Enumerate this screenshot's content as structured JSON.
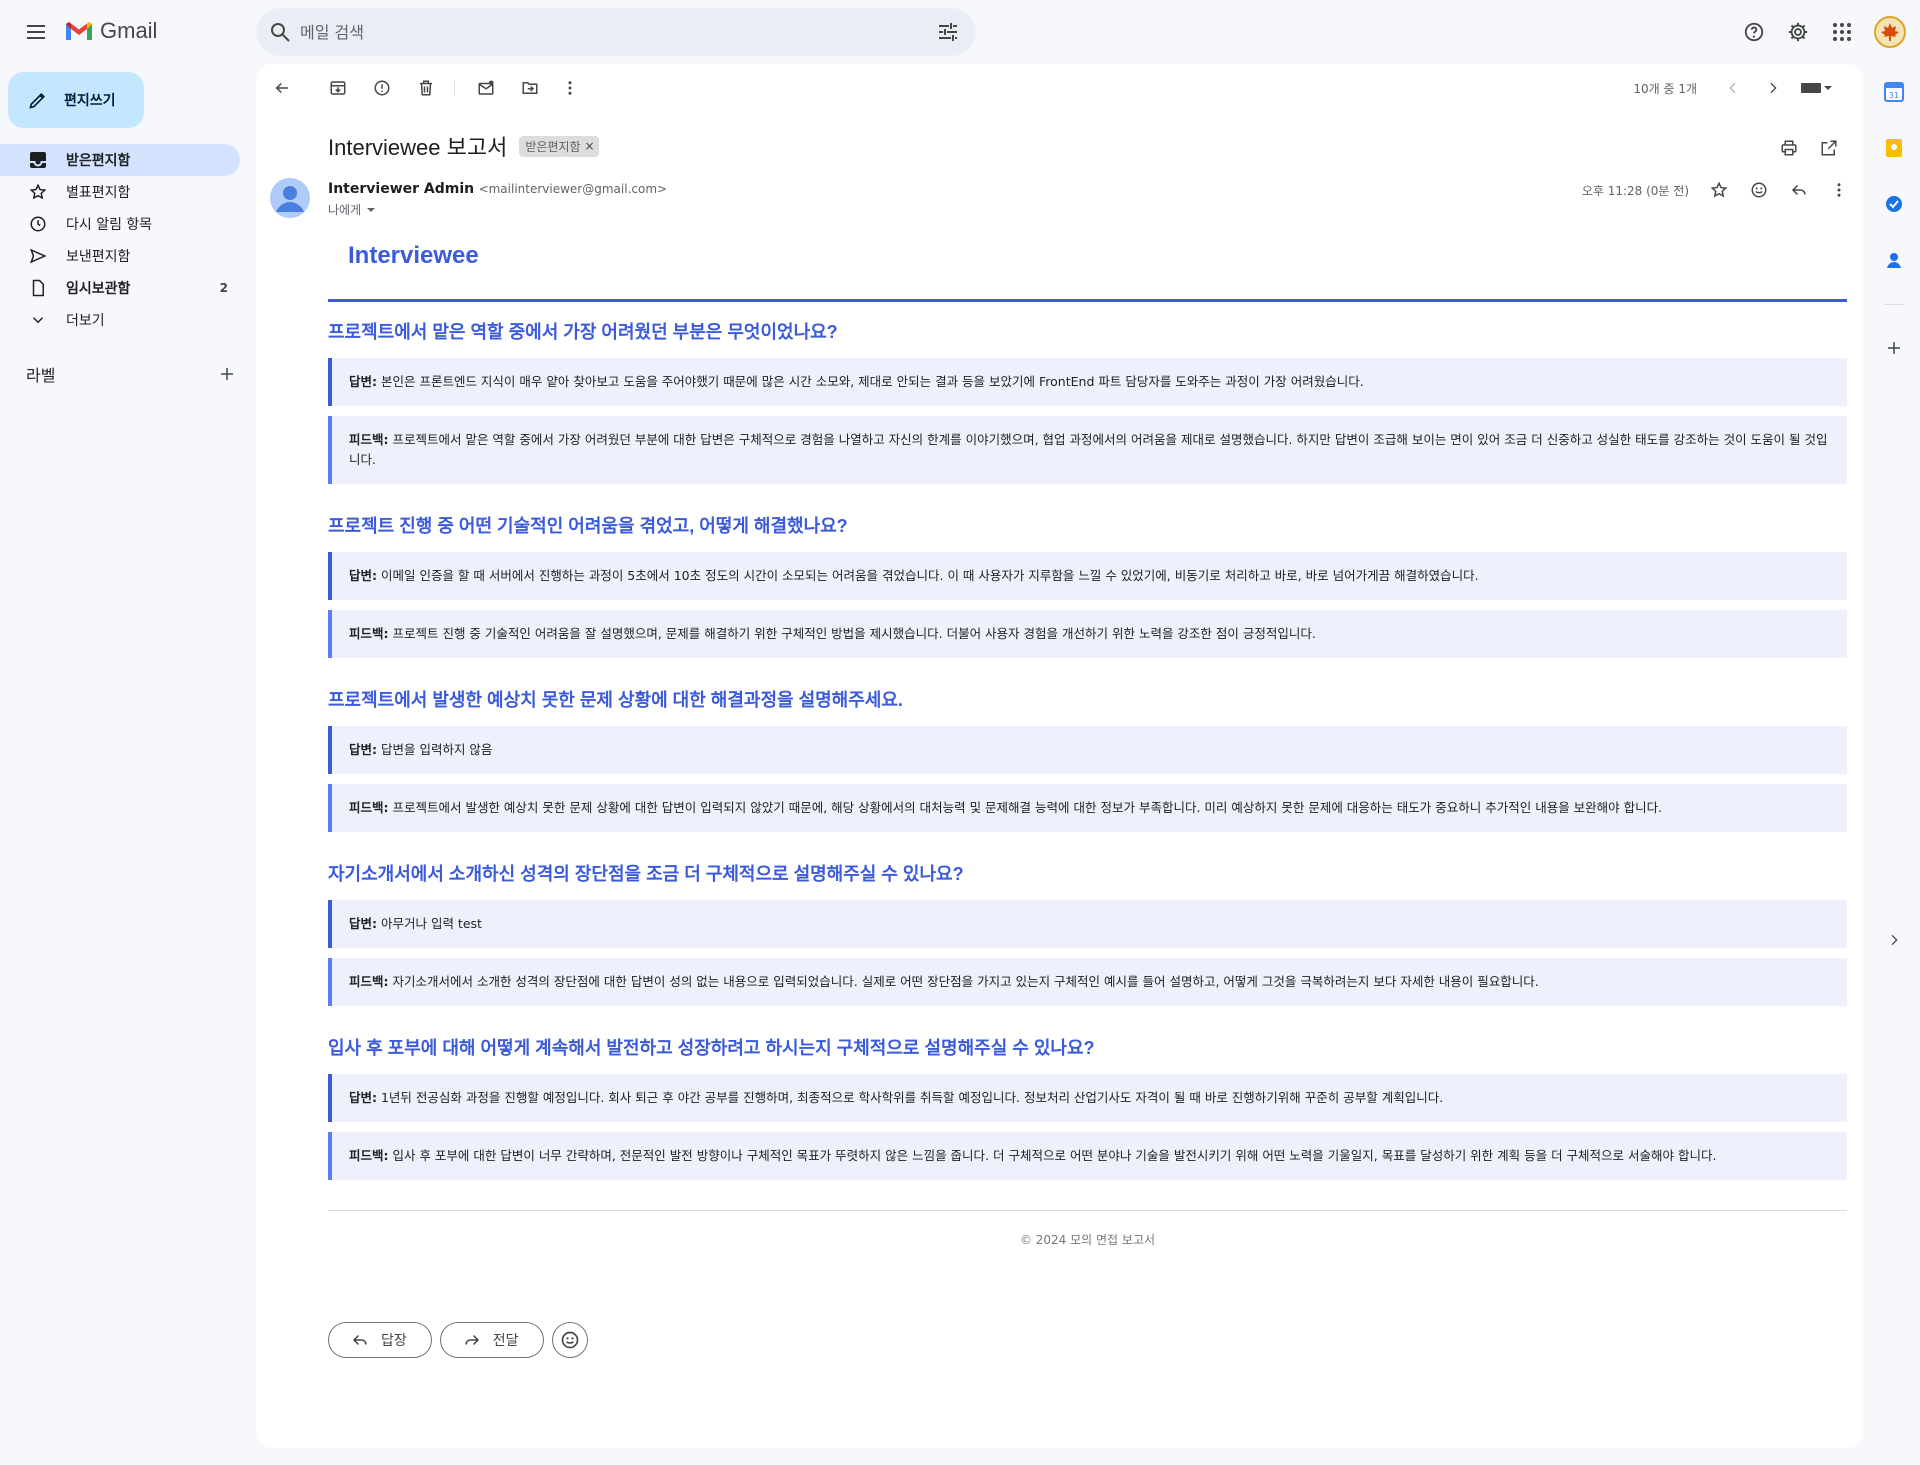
{
  "app": {
    "name": "Gmail"
  },
  "search": {
    "placeholder": "메일 검색"
  },
  "compose": {
    "label": "편지쓰기"
  },
  "nav": [
    {
      "label": "받은편지함",
      "count": "",
      "icon": "inbox-icon"
    },
    {
      "label": "별표편지함",
      "count": "",
      "icon": "star-icon"
    },
    {
      "label": "다시 알림 항목",
      "count": "",
      "icon": "clock-icon"
    },
    {
      "label": "보낸편지함",
      "count": "",
      "icon": "send-icon"
    },
    {
      "label": "임시보관함",
      "count": "2",
      "icon": "draft-icon"
    },
    {
      "label": "더보기",
      "count": "",
      "icon": "chevron-down-icon"
    }
  ],
  "labels_heading": "라벨",
  "pager": "10개 중 1개",
  "email": {
    "subject": "Interviewee 보고서",
    "label_chip": "받은편지함",
    "sender_name": "Interviewer Admin",
    "sender_email": "<mailinterviewer@gmail.com>",
    "to": "나에게",
    "time": "오후 11:28 (0분 전)"
  },
  "report": {
    "title": "Interviewee",
    "answer_label": "답변:",
    "feedback_label": "피드백:",
    "items": [
      {
        "question": "프로젝트에서 맡은 역할 중에서 가장 어려웠던 부분은 무엇이었나요?",
        "answer": "본인은 프론트엔드 지식이 매우 얕아 찾아보고 도움을 주어야했기 때문에 많은 시간 소모와, 제대로 안되는 결과 등을 보았기에 FrontEnd 파트 담당자를 도와주는 과정이 가장 어려웠습니다.",
        "feedback": "프로젝트에서 맡은 역할 중에서 가장 어려웠던 부분에 대한 답변은 구체적으로 경험을 나열하고 자신의 한계를 이야기했으며, 협업 과정에서의 어려움을 제대로 설명했습니다. 하지만 답변이 조급해 보이는 면이 있어 조금 더 신중하고 성실한 태도를 강조하는 것이 도움이 될 것입니다."
      },
      {
        "question": "프로젝트 진행 중 어떤 기술적인 어려움을 겪었고, 어떻게 해결했나요?",
        "answer": "이메일 인증을 할 때 서버에서 진행하는 과정이 5초에서 10초 정도의 시간이 소모되는 어려움을 겪었습니다. 이 때 사용자가 지루함을 느낄 수 있었기에, 비동기로 처리하고 바로, 바로 넘어가게끔 해결하였습니다.",
        "feedback": "프로젝트 진행 중 기술적인 어려움을 잘 설명했으며, 문제를 해결하기 위한 구체적인 방법을 제시했습니다. 더불어 사용자 경험을 개선하기 위한 노력을 강조한 점이 긍정적입니다."
      },
      {
        "question": "프로젝트에서 발생한 예상치 못한 문제 상황에 대한 해결과정을 설명해주세요.",
        "answer": "답변을 입력하지 않음",
        "feedback": "프로젝트에서 발생한 예상치 못한 문제 상황에 대한 답변이 입력되지 않았기 때문에, 해당 상황에서의 대처능력 및 문제해결 능력에 대한 정보가 부족합니다. 미리 예상하지 못한 문제에 대응하는 태도가 중요하니 추가적인 내용을 보완해야 합니다."
      },
      {
        "question": "자기소개서에서 소개하신 성격의 장단점을 조금 더 구체적으로 설명해주실 수 있나요?",
        "answer": "아무거나 입력 test",
        "feedback": "자기소개서에서 소개한 성격의 장단점에 대한 답변이 성의 없는 내용으로 입력되었습니다. 실제로 어떤 장단점을 가지고 있는지 구체적인 예시를 들어 설명하고, 어떻게 그것을 극복하려는지 보다 자세한 내용이 필요합니다."
      },
      {
        "question": "입사 후 포부에 대해 어떻게 계속해서 발전하고 성장하려고 하시는지 구체적으로 설명해주실 수 있나요?",
        "answer": "1년뒤 전공심화 과정을 진행할 예정입니다. 회사 퇴근 후 야간 공부를 진행하며, 최종적으로 학사학위를 취득할 예정입니다. 정보처리 산업기사도 자격이 될 때 바로 진행하기위해 꾸준히 공부할 계획입니다.",
        "feedback": "입사 후 포부에 대한 답변이 너무 간략하며, 전문적인 발전 방향이나 구체적인 목표가 뚜렷하지 않은 느낌을 줍니다. 더 구체적으로 어떤 분야나 기술을 발전시키기 위해 어떤 노력을 기울일지, 목표를 달성하기 위한 계획 등을 더 구체적으로 서술해야 합니다."
      }
    ],
    "footer": "© 2024 모의 면접 보고서"
  },
  "reply": {
    "reply_label": "답장",
    "forward_label": "전달"
  },
  "colors": {
    "accent": "#3b5bdb",
    "compose_bg": "#c2e7ff",
    "active_nav": "#d3e3fd"
  }
}
